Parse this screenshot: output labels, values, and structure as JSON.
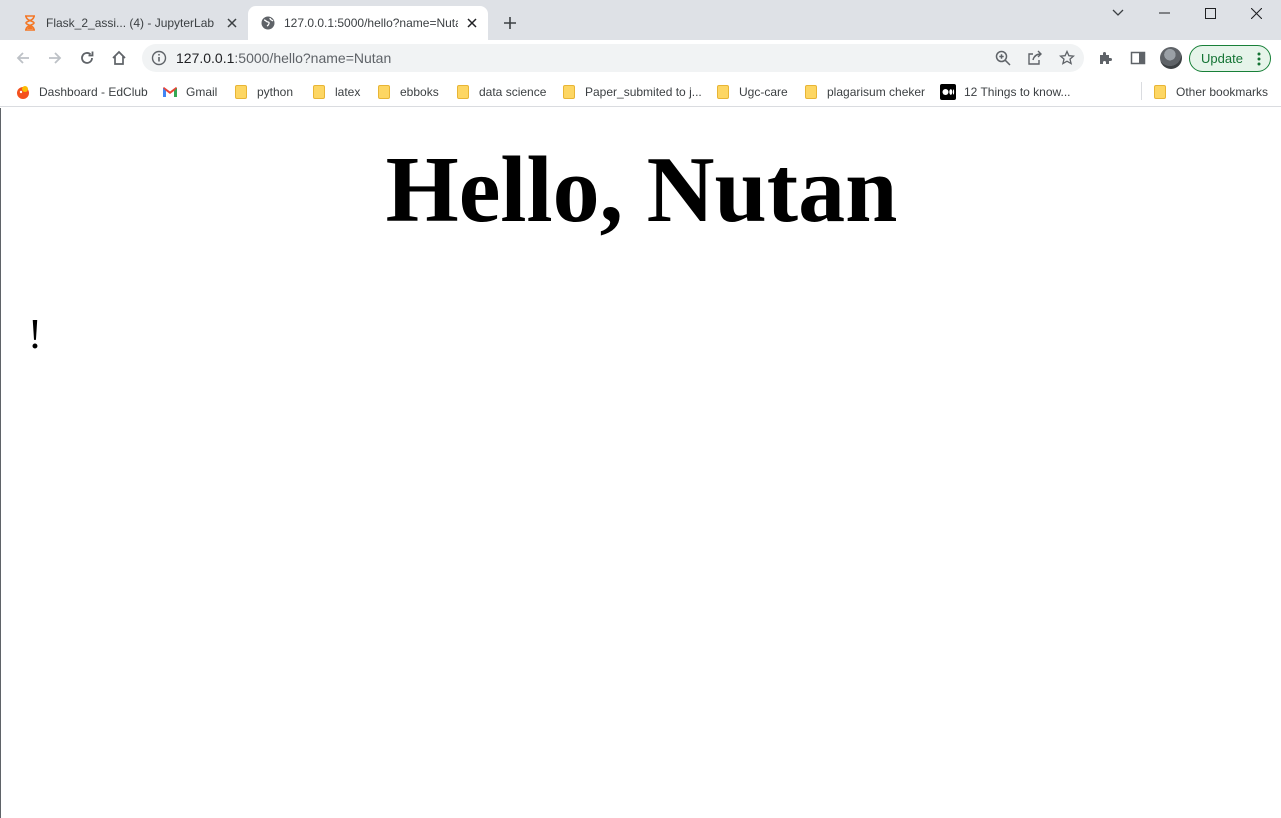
{
  "tabs": [
    {
      "title": "Flask_2_assi... (4) - JupyterLab",
      "active": false,
      "icon": "jupyter-hourglass-icon"
    },
    {
      "title": "127.0.0.1:5000/hello?name=Nutan",
      "active": true,
      "icon": "globe-icon"
    }
  ],
  "omnibox": {
    "url_host": "127.0.0.1",
    "url_rest": ":5000/hello?name=Nutan"
  },
  "toolbar": {
    "update_label": "Update"
  },
  "bookmarks": [
    {
      "label": "Dashboard - EdClub",
      "icon": "edclub-icon"
    },
    {
      "label": "Gmail",
      "icon": "gmail-icon"
    },
    {
      "label": "python",
      "icon": "folder-icon"
    },
    {
      "label": "latex",
      "icon": "folder-icon"
    },
    {
      "label": "ebboks",
      "icon": "folder-icon"
    },
    {
      "label": "data science",
      "icon": "folder-icon"
    },
    {
      "label": "Paper_submited to j...",
      "icon": "folder-icon"
    },
    {
      "label": "Ugc-care",
      "icon": "folder-icon"
    },
    {
      "label": "plagarisum cheker",
      "icon": "folder-icon"
    },
    {
      "label": "12 Things to know...",
      "icon": "medium-icon"
    }
  ],
  "other_bookmarks": {
    "label": "Other bookmarks",
    "icon": "folder-icon"
  },
  "page": {
    "heading": "Hello, Nutan",
    "exclamation": "!"
  },
  "colors": {
    "tabstrip_bg": "#dee1e6",
    "update_accent": "#188038"
  }
}
